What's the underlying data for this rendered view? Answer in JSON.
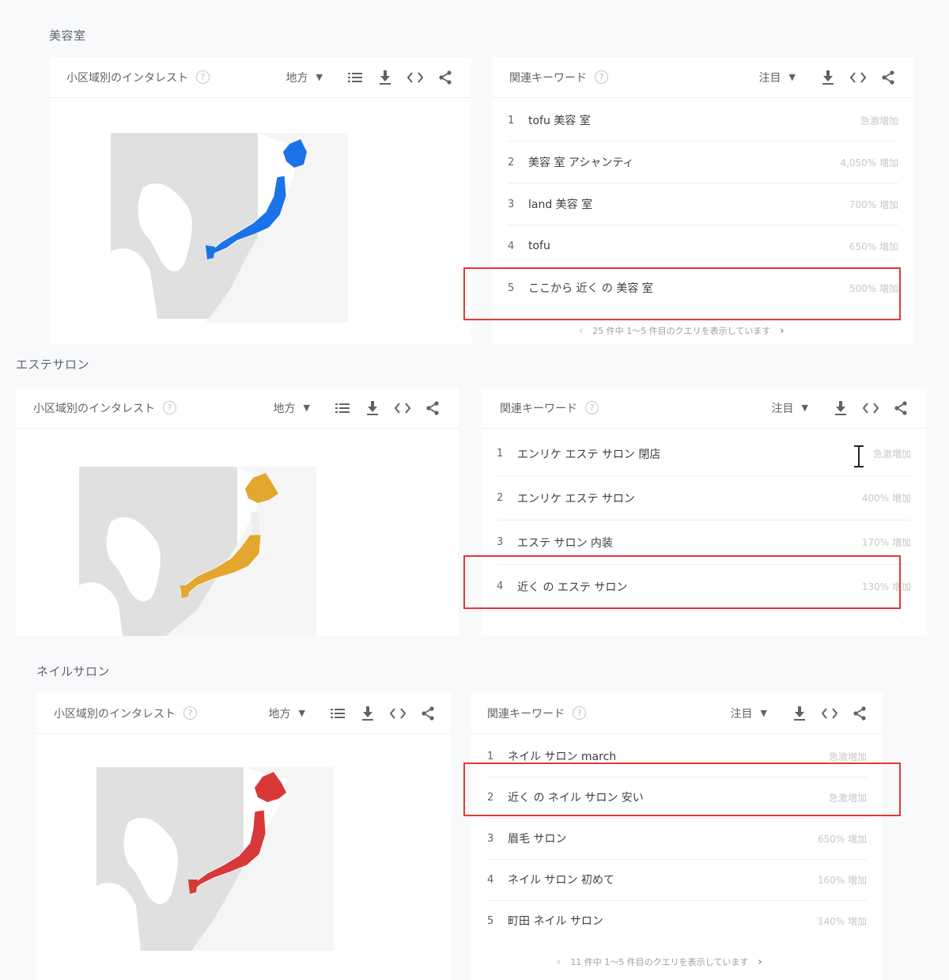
{
  "sections": [
    {
      "title": "美容室",
      "region_card": {
        "title": "小区域別のインタレスト",
        "dropdown": "地方",
        "help": "?"
      },
      "map": {
        "highlight_color": "#1a73e8"
      },
      "keywords_card": {
        "title": "関連キーワード",
        "dropdown": "注目",
        "help": "?",
        "rows": [
          {
            "rank": "1",
            "text": "tofu 美容 室",
            "value": "急激増加"
          },
          {
            "rank": "2",
            "text": "美容 室 アシャンティ",
            "value": "4,050% 増加"
          },
          {
            "rank": "3",
            "text": "land 美容 室",
            "value": "700% 増加"
          },
          {
            "rank": "4",
            "text": "tofu",
            "value": "650% 増加"
          },
          {
            "rank": "5",
            "text": "ここから 近く の 美容 室",
            "value": "500% 増加"
          }
        ],
        "pager": "25 件中 1～5 件目のクエリを表示しています"
      }
    },
    {
      "title": "エステサロン",
      "region_card": {
        "title": "小区域別のインタレスト",
        "dropdown": "地方",
        "help": "?"
      },
      "map": {
        "highlight_color": "#e3a72f"
      },
      "keywords_card": {
        "title": "関連キーワード",
        "dropdown": "注目",
        "help": "?",
        "rows": [
          {
            "rank": "1",
            "text": "エンリケ エステ サロン 閉店",
            "value": "急激増加"
          },
          {
            "rank": "2",
            "text": "エンリケ エステ サロン",
            "value": "400% 増加"
          },
          {
            "rank": "3",
            "text": "エステ サロン 内装",
            "value": "170% 増加"
          },
          {
            "rank": "4",
            "text": "近く の エステ サロン",
            "value": "130% 増加"
          }
        ]
      }
    },
    {
      "title": "ネイルサロン",
      "region_card": {
        "title": "小区域別のインタレスト",
        "dropdown": "地方",
        "help": "?"
      },
      "map": {
        "highlight_color": "#d93838"
      },
      "keywords_card": {
        "title": "関連キーワード",
        "dropdown": "注目",
        "help": "?",
        "rows": [
          {
            "rank": "1",
            "text": "ネイル サロン march",
            "value": "急激増加"
          },
          {
            "rank": "2",
            "text": "近く の ネイル サロン 安い",
            "value": "急激増加"
          },
          {
            "rank": "3",
            "text": "眉毛 サロン",
            "value": "650% 増加"
          },
          {
            "rank": "4",
            "text": "ネイル サロン 初めて",
            "value": "160% 増加"
          },
          {
            "rank": "5",
            "text": "町田 ネイル サロン",
            "value": "140% 増加"
          }
        ],
        "pager": "11 件中 1～5 件目のクエリを表示しています"
      }
    }
  ],
  "icons": {
    "help": "help-circle-icon",
    "caret": "caret-down-icon",
    "list": "list-icon",
    "download": "download-icon",
    "embed": "embed-code-icon",
    "share": "share-icon",
    "prev": "chevron-left-icon",
    "next": "chevron-right-icon",
    "cursor": "text-cursor-icon"
  },
  "glyphs": {
    "caret": "▼",
    "prev": "‹",
    "next": "›"
  },
  "colors": {
    "highlight_box": "#e53935",
    "map_land": "#e0e0e0",
    "japan_blue": "#1a73e8",
    "japan_yellow": "#e3a72f",
    "japan_red": "#d93838"
  }
}
